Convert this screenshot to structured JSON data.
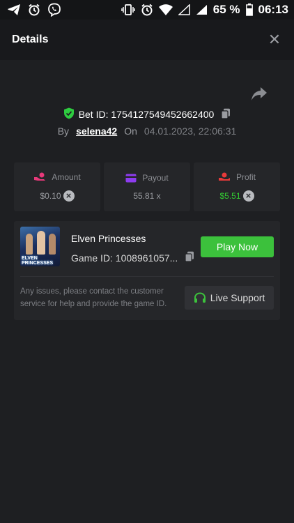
{
  "status_bar": {
    "battery": "65 %",
    "time": "06:13",
    "left_icons": [
      "telegram-icon",
      "alarm-icon",
      "viber-icon"
    ],
    "right_icons": [
      "vibrate-icon",
      "alarm-icon",
      "wifi-icon",
      "signal-empty-icon",
      "signal-icon",
      "battery-icon"
    ]
  },
  "header": {
    "title": "Details",
    "close": "✕"
  },
  "bet": {
    "id_label": "Bet ID: 1754127549452662400",
    "by_label": "By",
    "user": "selena42",
    "on_label": "On",
    "date": "04.01.2023, 22:06:31"
  },
  "stats": [
    {
      "label": "Amount",
      "value": "$0.10",
      "icon": "hand-coins-icon",
      "icon_color": "#e8397a",
      "remove": "×"
    },
    {
      "label": "Payout",
      "value": "55.81 x",
      "icon": "card-icon",
      "icon_color": "#8e3cf0"
    },
    {
      "label": "Profit",
      "value": "$5.51",
      "icon": "hand-money-icon",
      "icon_color": "#e83a3a",
      "value_color": "#33cc33",
      "remove": "×"
    }
  ],
  "game": {
    "name": "Elven Princesses",
    "game_id": "Game ID: 1008961057...",
    "thumb_text": "ELVEN PRINCESSES",
    "play_label": "Play Now",
    "issues_text": "Any issues, please contact the customer service for help and provide the game ID.",
    "support_label": "Live Support"
  },
  "colors": {
    "background": "#1e1f22",
    "card": "#252629",
    "accent_green": "#3cc13c",
    "verified_green": "#2ecc40"
  }
}
